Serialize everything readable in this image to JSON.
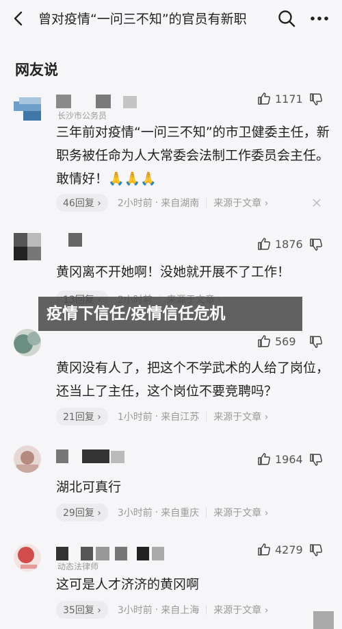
{
  "header": {
    "title": "曾对疫情“一问三不知”的官员有新职"
  },
  "section": {
    "title": "网友说"
  },
  "banner": {
    "text": "疫情下信任/疫情信任危机"
  },
  "comments": [
    {
      "subtitle": "长沙市公务员",
      "text": "三年前对疫情“一问三不知”的市卫健委主任，新职务被任命为人大常委会法制工作委员会主任。敢情好！🙏🙏🙏",
      "likes": "1171",
      "replies": "46回复 ›",
      "time": "2小时前",
      "location": "来自湖南",
      "source": "来源于文章 ›"
    },
    {
      "subtitle": "",
      "text": "黄冈离不开她啊！没她就开展不了工作！",
      "likes": "1876",
      "replies": "13回复 ›",
      "time": "2小时前",
      "location": "",
      "source": "来源于文章 ›"
    },
    {
      "subtitle": "",
      "text": "黄冈没有人了，把这个不学武术的人给了岗位，还当上了主任，这个岗位不要竞聘吗？",
      "likes": "569",
      "replies": "21回复 ›",
      "time": "1小时前",
      "location": "来自江苏",
      "source": "来源于文章 ›"
    },
    {
      "subtitle": "",
      "text": "湖北可真行",
      "likes": "1964",
      "replies": "29回复 ›",
      "time": "3小时前",
      "location": "来自重庆",
      "source": "来源于文章 ›"
    },
    {
      "subtitle": "动态法律师",
      "text": "这可是人才济济的黄冈啊",
      "likes": "4279",
      "replies": "35回复 ›",
      "time": "3小时前",
      "location": "来自上海",
      "source": "来源于文章 ›"
    }
  ]
}
